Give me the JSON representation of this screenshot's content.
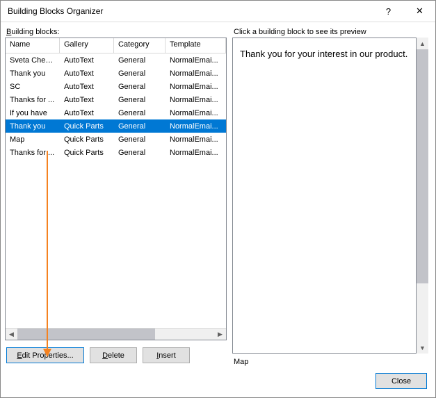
{
  "title": "Building Blocks Organizer",
  "titlebar_buttons": {
    "help": "?",
    "close": "✕"
  },
  "left": {
    "label": "Building blocks:",
    "columns": {
      "name": "Name",
      "gallery": "Gallery",
      "category": "Category",
      "template": "Template"
    },
    "rows": [
      {
        "name": "Sveta Cheu...",
        "gallery": "AutoText",
        "category": "General",
        "template": "NormalEmai...",
        "selected": false
      },
      {
        "name": "Thank you",
        "gallery": "AutoText",
        "category": "General",
        "template": "NormalEmai...",
        "selected": false
      },
      {
        "name": "SC",
        "gallery": "AutoText",
        "category": "General",
        "template": "NormalEmai...",
        "selected": false
      },
      {
        "name": "Thanks for ...",
        "gallery": "AutoText",
        "category": "General",
        "template": "NormalEmai...",
        "selected": false
      },
      {
        "name": "If you have",
        "gallery": "AutoText",
        "category": "General",
        "template": "NormalEmai...",
        "selected": false
      },
      {
        "name": "Thank you",
        "gallery": "Quick Parts",
        "category": "General",
        "template": "NormalEmai...",
        "selected": true
      },
      {
        "name": "Map",
        "gallery": "Quick Parts",
        "category": "General",
        "template": "NormalEmai...",
        "selected": false
      },
      {
        "name": "Thanks for ...",
        "gallery": "Quick Parts",
        "category": "General",
        "template": "NormalEmai...",
        "selected": false
      }
    ],
    "buttons": {
      "edit_properties": "Edit Properties...",
      "delete": "Delete",
      "insert": "Insert"
    }
  },
  "right": {
    "label": "Click a building block to see its preview",
    "preview_text": "Thank you for your interest in our product.",
    "preview_name": "Map"
  },
  "footer": {
    "close": "Close"
  }
}
